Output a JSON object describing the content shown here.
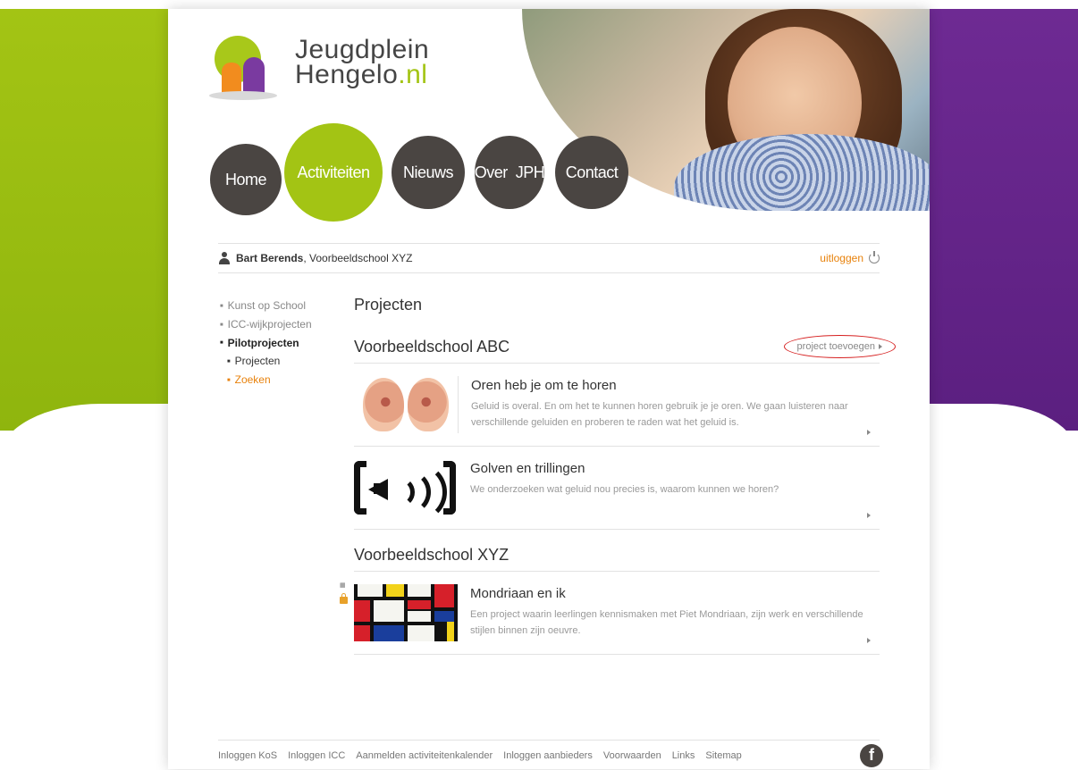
{
  "brand": {
    "logo_line1": "Jeugdplein",
    "logo_line2": "Hengelo",
    "logo_suffix": ".nl",
    "colors": {
      "green": "#a3c414",
      "purple": "#6e2a93",
      "dark": "#4a4542",
      "orange": "#e8820c"
    }
  },
  "nav": {
    "items": [
      {
        "label": "Home"
      },
      {
        "label": "Activiteiten",
        "active": true
      },
      {
        "label": "Nieuws"
      },
      {
        "label": "Over  JPH"
      },
      {
        "label": "Contact"
      }
    ]
  },
  "user": {
    "icon": "user-icon",
    "name": "Bart Berends",
    "school": ", Voorbeeldschool XYZ",
    "logout_label": "uitloggen",
    "logout_icon": "power-icon"
  },
  "sidebar": {
    "items": [
      {
        "label": "Kunst op School"
      },
      {
        "label": "ICC-wijkprojecten"
      },
      {
        "label": "Pilotprojecten"
      },
      {
        "label": "Projecten"
      },
      {
        "label": "Zoeken"
      }
    ]
  },
  "main": {
    "title": "Projecten",
    "sections": [
      {
        "heading": "Voorbeeldschool ABC",
        "add_label": "project toevoegen",
        "projects": [
          {
            "title": "Oren heb je om te horen",
            "description": "Geluid is overal. En om het te kunnen horen gebruik je je oren. We gaan luisteren naar verschillende geluiden en proberen te raden wat het geluid is.",
            "thumb_icon": "ears-image"
          },
          {
            "title": "Golven en trillingen",
            "description": "We onderzoeken wat geluid nou precies is, waarom kunnen we horen?",
            "thumb_icon": "speaker-image"
          }
        ]
      },
      {
        "heading": "Voorbeeldschool XYZ",
        "projects": [
          {
            "title": "Mondriaan en ik",
            "description": "Een project waarin leerlingen kennismaken met Piet Mondriaan, zijn werk en verschillende stijlen binnen zijn oeuvre.",
            "thumb_icon": "mondrian-image"
          }
        ]
      }
    ]
  },
  "footer": {
    "links": [
      "Inloggen KoS",
      "Inloggen ICC",
      "Aanmelden activiteitenkalender",
      "Inloggen aanbieders",
      "Voorwaarden",
      "Links",
      "Sitemap"
    ],
    "social_icon": "facebook-icon"
  }
}
